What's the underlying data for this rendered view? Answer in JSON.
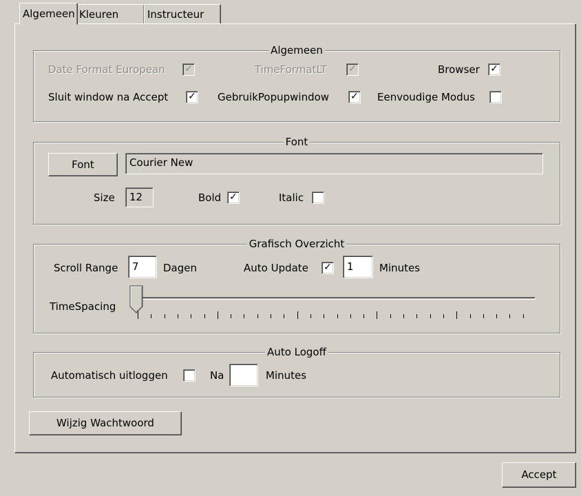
{
  "tabs": [
    "Algemeen",
    "Kleuren",
    "Instructeur"
  ],
  "active_tab": "Algemeen",
  "group_algemeen": {
    "title": "Algemeen",
    "date_format_label": "Date Format European",
    "date_format_checked": true,
    "time_format_label": "TimeFormatLT",
    "time_format_checked": true,
    "browser_label": "Browser",
    "browser_checked": true,
    "sluit_label": "Sluit window na Accept",
    "sluit_checked": true,
    "popup_label": "GebruikPopupwindow",
    "popup_checked": true,
    "eenvoudig_label": "Eenvoudige Modus",
    "eenvoudig_checked": false
  },
  "group_font": {
    "title": "Font",
    "font_button": "Font",
    "font_name": "Courier New",
    "size_label": "Size",
    "size_value": "12",
    "bold_label": "Bold",
    "bold_checked": true,
    "italic_label": "Italic",
    "italic_checked": false
  },
  "group_grafisch": {
    "title": "Grafisch Overzicht",
    "scroll_range_label": "Scroll Range",
    "scroll_range_value": "7",
    "dagen_label": "Dagen",
    "auto_update_label": "Auto Update",
    "auto_update_checked": true,
    "auto_update_value": "1",
    "minutes_label": "Minutes",
    "timespacing_label": "TimeSpacing",
    "timespacing_value": 0
  },
  "group_logoff": {
    "title": "Auto Logoff",
    "auto_logout_label": "Automatisch uitloggen",
    "auto_logout_checked": false,
    "na_label": "Na",
    "na_value": "",
    "minutes_label": "Minutes"
  },
  "wijzig_button": "Wijzig Wachtwoord",
  "accept_button": "Accept",
  "check_glyph": "✓"
}
